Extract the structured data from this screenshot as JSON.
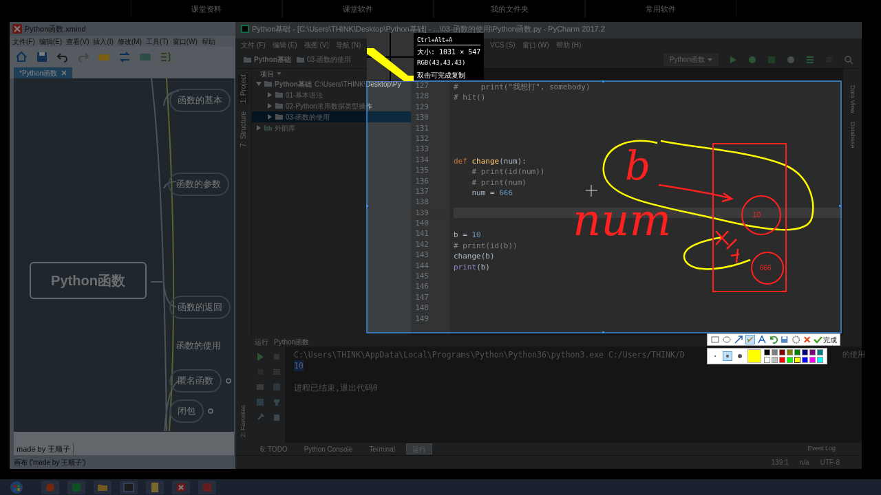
{
  "top_tabs": [
    "课堂资料",
    "课堂软件",
    "我的文件夹",
    "常用软件"
  ],
  "xmind": {
    "title": "Python函数.xmind",
    "menu": [
      "文件(F)",
      "编辑(E)",
      "查看(V)",
      "插入(I)",
      "修改(M)",
      "工具(T)",
      "窗口(W)",
      "帮助"
    ],
    "tab": "*Python函数",
    "central_topic": "Python函数",
    "topics": [
      {
        "label": "函数的基本",
        "kind": "oval",
        "marker": false
      },
      {
        "label": "函数的参数",
        "kind": "oval",
        "marker": false
      },
      {
        "label": "函数的返回",
        "kind": "oval",
        "marker": false
      },
      {
        "label": "函数的使用",
        "kind": "plain",
        "marker": false
      },
      {
        "label": "匿名函数",
        "kind": "oval",
        "marker": true
      },
      {
        "label": "闭包",
        "kind": "oval",
        "marker": true
      }
    ],
    "note": "made by 王顺子",
    "status": "画布 ('made by 王顺子')"
  },
  "pycharm": {
    "title": "Python基础 - [C:\\Users\\THINK\\Desktop\\Python基础] - ...\\03-函数的使用\\Python函数.py - PyCharm 2017.2",
    "menu_left": [
      "文件 (F)",
      "编辑 (E)",
      "视图 (V)",
      "导航 (N)"
    ],
    "menu_right": [
      "VCS (S)",
      "窗口 (W)",
      "帮助 (H)"
    ],
    "breadcrumbs": [
      "Python基础",
      "03-函数的使用"
    ],
    "run_config": "Python函数",
    "left_tabs": [
      "1: Project",
      "7: Structure"
    ],
    "favorites_tab": "2: Favorites",
    "right_tabs": [
      "Data View",
      "Database"
    ],
    "project": {
      "header": "项目",
      "items": [
        {
          "label": "Python基础",
          "path": "C:\\Users\\THINK\\Desktop\\Py",
          "kind": "folder",
          "expanded": true,
          "selected": false,
          "children": [
            {
              "label": "01-基本语法",
              "kind": "folder",
              "expanded": false,
              "selected": false
            },
            {
              "label": "02-Python常用数据类型操作",
              "kind": "folder",
              "expanded": false,
              "selected": false
            },
            {
              "label": "03-函数的使用",
              "kind": "folder",
              "expanded": false,
              "selected": true
            }
          ]
        },
        {
          "label": "外部库",
          "kind": "library",
          "expanded": false,
          "selected": false
        }
      ]
    },
    "code": [
      {
        "number": "127",
        "current": false,
        "tokens": [
          {
            "kind": "comment",
            "text": "#     print(\"我想打\", somebody)"
          }
        ]
      },
      {
        "number": "128",
        "current": false,
        "tokens": [
          {
            "kind": "comment",
            "text": "# hit()"
          }
        ]
      },
      {
        "number": "129",
        "current": false
      },
      {
        "number": "130",
        "current": false
      },
      {
        "number": "131",
        "current": false
      },
      {
        "number": "132",
        "current": false
      },
      {
        "number": "133",
        "current": false
      },
      {
        "number": "134",
        "current": false,
        "tokens": [
          {
            "kind": "keyword",
            "text": "def "
          },
          {
            "kind": "function",
            "text": "change"
          },
          {
            "kind": "plain",
            "text": "(num):"
          }
        ]
      },
      {
        "number": "135",
        "current": false,
        "tokens": [
          {
            "kind": "comment",
            "text": "    # print(id(num))"
          }
        ]
      },
      {
        "number": "136",
        "current": false,
        "tokens": [
          {
            "kind": "comment",
            "text": "    # print(num)"
          }
        ]
      },
      {
        "number": "137",
        "current": false,
        "tokens": [
          {
            "kind": "plain",
            "text": "    num = "
          },
          {
            "kind": "number",
            "text": "666"
          }
        ]
      },
      {
        "number": "138",
        "current": false
      },
      {
        "number": "139",
        "current": true
      },
      {
        "number": "140",
        "current": false
      },
      {
        "number": "141",
        "current": false,
        "tokens": [
          {
            "kind": "plain",
            "text": "b = "
          },
          {
            "kind": "number",
            "text": "10"
          }
        ]
      },
      {
        "number": "142",
        "current": false,
        "tokens": [
          {
            "kind": "comment",
            "text": "# print(id(b))"
          }
        ]
      },
      {
        "number": "143",
        "current": false,
        "tokens": [
          {
            "kind": "plain",
            "text": "change(b)"
          }
        ]
      },
      {
        "number": "144",
        "current": false,
        "tokens": [
          {
            "kind": "builtin",
            "text": "print"
          },
          {
            "kind": "plain",
            "text": "(b)"
          }
        ]
      },
      {
        "number": "145",
        "current": false
      },
      {
        "number": "146",
        "current": false
      },
      {
        "number": "147",
        "current": false
      },
      {
        "number": "148",
        "current": false
      },
      {
        "number": "149",
        "current": false
      }
    ],
    "run_header": [
      "运行",
      "Python函数"
    ],
    "output": [
      {
        "kind": "command",
        "text": "C:\\Users\\THINK\\AppData\\Local\\Programs\\Python\\Python36\\python3.exe C:/Users/THINK/D"
      },
      {
        "kind": "result",
        "text": "10"
      },
      {
        "kind": "info",
        "text": "进程已结束,退出代码0"
      }
    ],
    "output_tail": "的使用",
    "bottom_tabs": [
      {
        "label": "6: TODO",
        "selected": false
      },
      {
        "label": "Python Console",
        "selected": false
      },
      {
        "label": "Terminal",
        "selected": false
      },
      {
        "label": "运行",
        "selected": true
      }
    ],
    "event_log": "Event Log",
    "status": [
      "139:1",
      "n/a",
      "UTF-8"
    ]
  },
  "capture": {
    "shortcut": "Ctrl+Alt+A",
    "size": "大小: 1031 × 547",
    "rgb": "RGB(43,43,43)",
    "hint": "双击可完成复制",
    "tools": [
      {
        "kind": "rect",
        "selected": false
      },
      {
        "kind": "ellipse",
        "selected": false
      },
      {
        "kind": "arrow",
        "selected": false
      },
      {
        "kind": "brush",
        "selected": true
      },
      {
        "kind": "text",
        "selected": false
      }
    ],
    "finish": "完成",
    "sizes": [
      {
        "selected": false
      },
      {
        "selected": true
      },
      {
        "selected": false
      }
    ],
    "palette": [
      {
        "color": "#000000",
        "selected": false
      },
      {
        "color": "#808080",
        "selected": false
      },
      {
        "color": "#800000",
        "selected": false
      },
      {
        "color": "#808000",
        "selected": false
      },
      {
        "color": "#008000",
        "selected": false
      },
      {
        "color": "#000080",
        "selected": false
      },
      {
        "color": "#800080",
        "selected": false
      },
      {
        "color": "#008080",
        "selected": false
      },
      {
        "color": "#ffffff",
        "selected": false
      },
      {
        "color": "#c0c0c0",
        "selected": false
      },
      {
        "color": "#ff0000",
        "selected": false
      },
      {
        "color": "#00ff00",
        "selected": false
      },
      {
        "color": "#ffff00",
        "selected": true
      },
      {
        "color": "#0000ff",
        "selected": false
      },
      {
        "color": "#ff00ff",
        "selected": false
      },
      {
        "color": "#00ffff",
        "selected": false
      }
    ]
  },
  "annotations": {
    "handwriting": [
      "b",
      "num"
    ],
    "labels": [
      "10",
      "666"
    ]
  }
}
